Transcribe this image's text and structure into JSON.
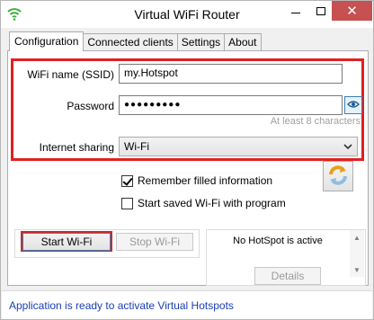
{
  "window": {
    "title": "Virtual WiFi Router",
    "minimize": "—",
    "maximize": "☐",
    "close": "✕"
  },
  "tabs": [
    {
      "label": "Configuration",
      "active": true
    },
    {
      "label": "Connected clients",
      "active": false
    },
    {
      "label": "Settings",
      "active": false
    },
    {
      "label": "About",
      "active": false
    }
  ],
  "config": {
    "ssid_label": "WiFi name (SSID)",
    "ssid_value": "my.Hotspot",
    "password_label": "Password",
    "password_value": "●●●●●●●●●",
    "password_hint": "At least 8 characters",
    "sharing_label": "Internet sharing",
    "sharing_value": "Wi-Fi",
    "remember_label": "Remember filled information",
    "remember_checked": true,
    "startsaved_label": "Start saved Wi-Fi with program",
    "startsaved_checked": false
  },
  "actions": {
    "start_label": "Start Wi-Fi",
    "stop_label": "Stop Wi-Fi",
    "hotspot_status": "No HotSpot is active",
    "details_label": "Details"
  },
  "status": {
    "text": "Application is ready to activate Virtual Hotspots"
  },
  "colors": {
    "highlight": "#e02020",
    "status_text": "#1a3fb5",
    "close_button": "#c75050"
  },
  "icons": {
    "app": "wifi-icon",
    "show_password": "eye-icon",
    "refresh": "refresh-icon",
    "dropdown": "chevron-down-icon"
  }
}
